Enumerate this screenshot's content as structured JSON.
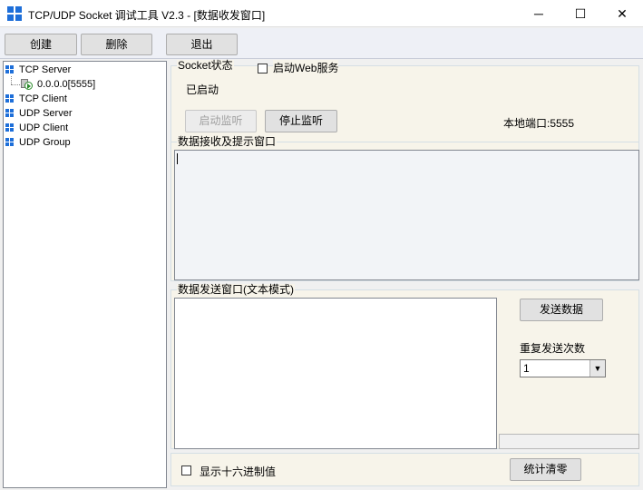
{
  "window": {
    "title": "TCP/UDP Socket 调试工具 V2.3 - [数据收发窗口]",
    "minimize_glyph": "─",
    "maximize_glyph": "☐",
    "close_glyph": "✕"
  },
  "toolbar": {
    "create_label": "创建",
    "delete_label": "删除",
    "exit_label": "退出"
  },
  "tree": {
    "items": [
      {
        "label": "TCP Server"
      },
      {
        "label": "0.0.0.0[5555]"
      },
      {
        "label": "TCP Client"
      },
      {
        "label": "UDP Server"
      },
      {
        "label": "UDP Client"
      },
      {
        "label": "UDP Group"
      }
    ]
  },
  "socket_status": {
    "legend": "Socket状态",
    "web_service_label": "启动Web服务",
    "web_service_checked": false,
    "status_text": "已启动",
    "start_listen_label": "启动监听",
    "stop_listen_label": "停止监听",
    "local_port_text": "本地端口:5555"
  },
  "receive": {
    "legend": "数据接收及提示窗口",
    "content": ""
  },
  "send": {
    "legend": "数据发送窗口(文本模式)",
    "content": "",
    "send_button_label": "发送数据",
    "repeat_label": "重复发送次数",
    "repeat_value": "1"
  },
  "bottom": {
    "hex_label": "显示十六进制值",
    "hex_checked": false,
    "reset_stats_label": "统计清零"
  }
}
